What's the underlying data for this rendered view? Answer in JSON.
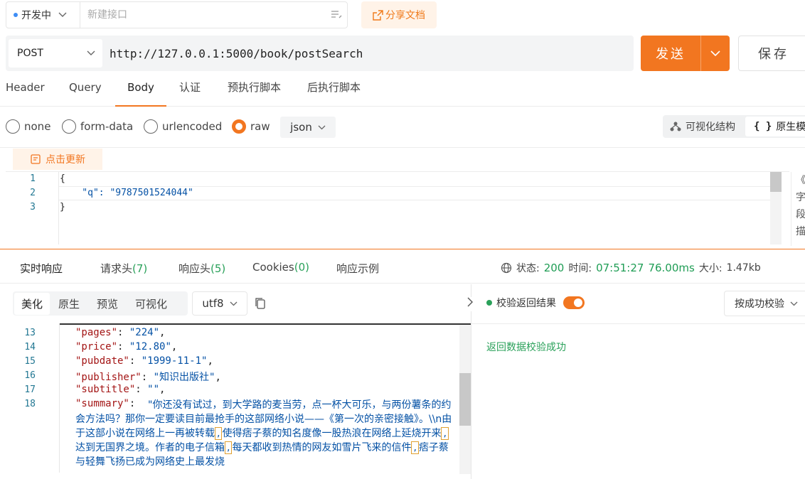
{
  "topbar": {
    "env_label": "开发中",
    "name_placeholder": "新建接口",
    "share_label": "分享文档"
  },
  "request": {
    "method": "POST",
    "url": "http://127.0.0.1:5000/book/postSearch",
    "send_label": "发送",
    "save_label": "保存"
  },
  "request_tabs": [
    "Header",
    "Query",
    "Body",
    "认证",
    "预执行脚本",
    "后执行脚本"
  ],
  "active_request_tab": "Body",
  "body_types": [
    "none",
    "form-data",
    "urlencoded",
    "raw"
  ],
  "selected_body_type": "raw",
  "body_format": "json",
  "view_switch": {
    "visual": "可视化结构",
    "raw": "原生模"
  },
  "refresh_label": "点击更新",
  "request_editor": {
    "line_numbers": [
      "1",
      "2",
      "3"
    ],
    "lines": [
      "{",
      "    \"q\": \"9787501524044\"",
      "}"
    ]
  },
  "side_text": [
    "《",
    "字",
    "段",
    "描"
  ],
  "response_tabs": [
    {
      "label": "实时响应",
      "count": ""
    },
    {
      "label": "请求头",
      "count": "(7)"
    },
    {
      "label": "响应头",
      "count": "(5)"
    },
    {
      "label": "Cookies",
      "count": "(0)"
    },
    {
      "label": "响应示例",
      "count": ""
    }
  ],
  "status_bar": {
    "status_label": "状态:",
    "status_value": "200",
    "time_label": "时间:",
    "time_value": "07:51:27",
    "duration": "76.00ms",
    "size_label": "大小:",
    "size_value": "1.47kb"
  },
  "response_view_tabs": [
    "美化",
    "原生",
    "预览",
    "可视化"
  ],
  "encoding": "utf8",
  "response_lines": [
    {
      "n": "13",
      "key": "\"pages\"",
      "val": "\"224\""
    },
    {
      "n": "14",
      "key": "\"price\"",
      "val": "\"12.80\""
    },
    {
      "n": "15",
      "key": "\"pubdate\"",
      "val": "\"1999-11-1\""
    },
    {
      "n": "16",
      "key": "\"publisher\"",
      "val": "\"知识出版社\""
    },
    {
      "n": "17",
      "key": "\"subtitle\"",
      "val": "\"\""
    },
    {
      "n": "18",
      "key": "\"summary\"",
      "val": ""
    }
  ],
  "summary_parts": [
    "\"你还没有试过，到大学路的麦当劳，点一杯大可乐，与两份薯条的约会方法吗？那你一定要读目前最抢手的这部网络小说——《第一次的亲密接触》。\\\\n由于这部小说在网络上一再被转载",
    ",",
    "使得痞子蔡的知名度像一股热浪在网络上延烧开来",
    ",",
    "达到无国界之境。作者的电子信箱",
    ",",
    "每天都收到热情的网友如雪片飞来的信件",
    ",",
    "痞子蔡与轻舞飞扬已成为网络史上最发烧"
  ],
  "verify": {
    "label": "校验返回结果",
    "mode": "按成功校验",
    "message": "返回数据校验成功"
  }
}
